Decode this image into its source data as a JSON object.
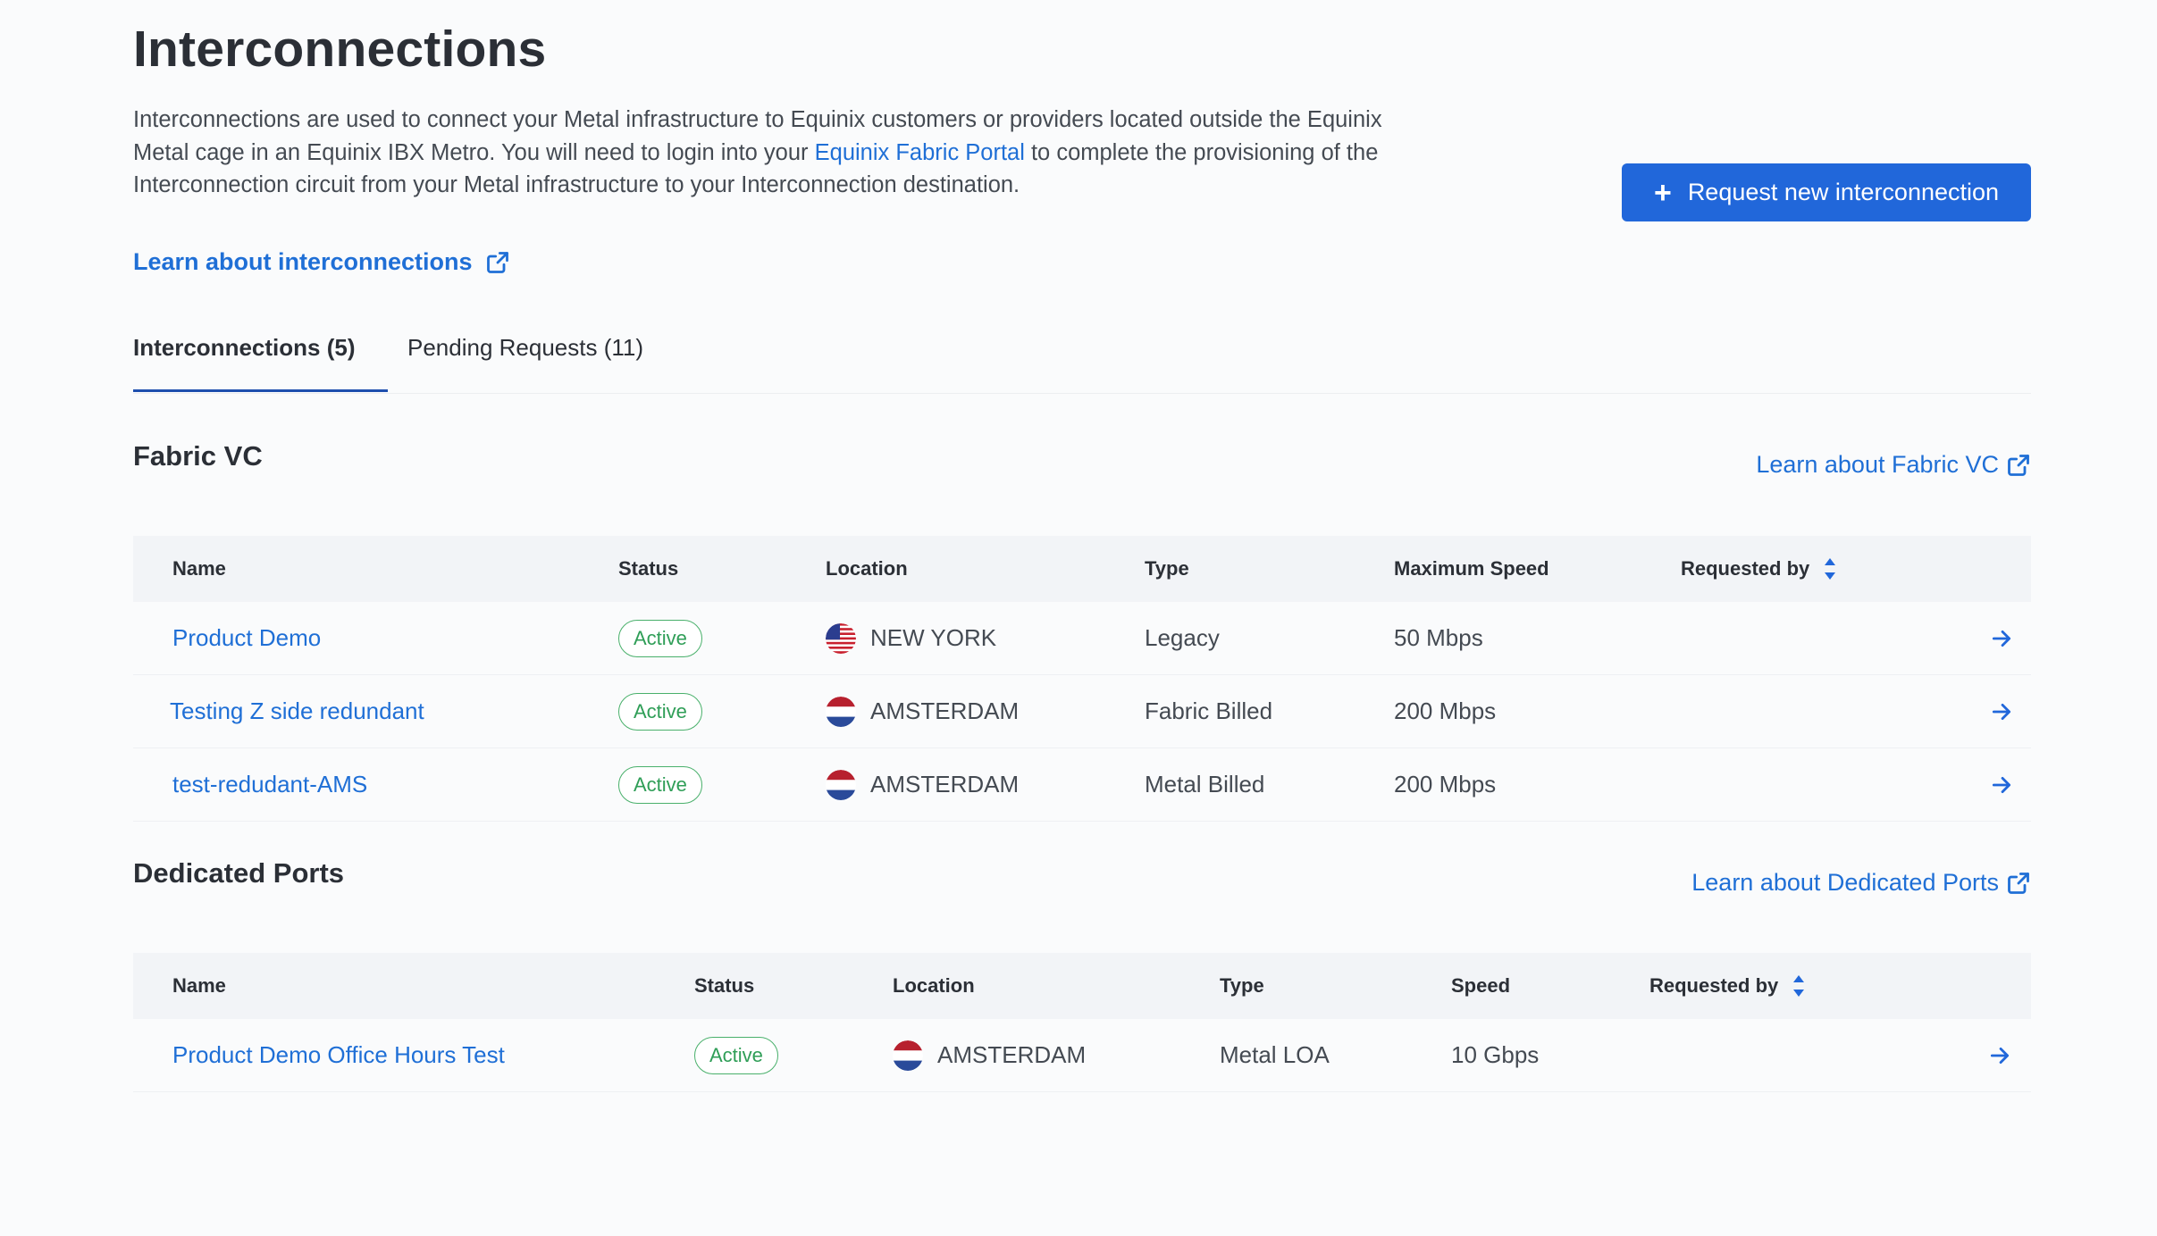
{
  "header": {
    "title": "Interconnections",
    "description_before_link": "Interconnections are used to connect your Metal infrastructure to Equinix customers or providers located outside the Equinix Metal cage in an Equinix IBX Metro. You will need to login into your ",
    "description_link": "Equinix Fabric Portal",
    "description_after_link": "  to complete the provisioning of the Interconnection circuit from your Metal infrastructure to your Interconnection destination.",
    "learn_link": "Learn about interconnections",
    "request_button": "Request new interconnection"
  },
  "tabs": [
    {
      "label": "Interconnections (5)",
      "active": true
    },
    {
      "label": "Pending Requests (11)",
      "active": false
    }
  ],
  "fabric_vc": {
    "title": "Fabric VC",
    "learn_link": "Learn about Fabric VC",
    "columns": [
      "Name",
      "Status",
      "Location",
      "Type",
      "Maximum Speed",
      "Requested by"
    ],
    "rows": [
      {
        "name": "Product Demo",
        "status": "Active",
        "location": "NEW YORK",
        "flag": "us-flag-icon",
        "type": "Legacy",
        "speed": "50 Mbps",
        "requested_by": ""
      },
      {
        "name": "Testing Z side redundant",
        "status": "Active",
        "location": "AMSTERDAM",
        "flag": "nl-flag-icon",
        "type": "Fabric Billed",
        "speed": "200 Mbps",
        "requested_by": ""
      },
      {
        "name": "test-redudant-AMS",
        "status": "Active",
        "location": "AMSTERDAM",
        "flag": "nl-flag-icon",
        "type": "Metal Billed",
        "speed": "200 Mbps",
        "requested_by": ""
      }
    ]
  },
  "dedicated_ports": {
    "title": "Dedicated Ports",
    "learn_link": "Learn about Dedicated Ports",
    "columns": [
      "Name",
      "Status",
      "Location",
      "Type",
      "Speed",
      "Requested by"
    ],
    "rows": [
      {
        "name": "Product Demo Office Hours Test",
        "status": "Active",
        "location": "AMSTERDAM",
        "flag": "nl-flag-icon",
        "type": "Metal LOA",
        "speed": "10 Gbps",
        "requested_by": ""
      }
    ]
  },
  "colors": {
    "accent": "#2167da",
    "link": "#1f6fd6",
    "active_badge": "#2f9e57",
    "tab_underline": "#1e4fae"
  }
}
